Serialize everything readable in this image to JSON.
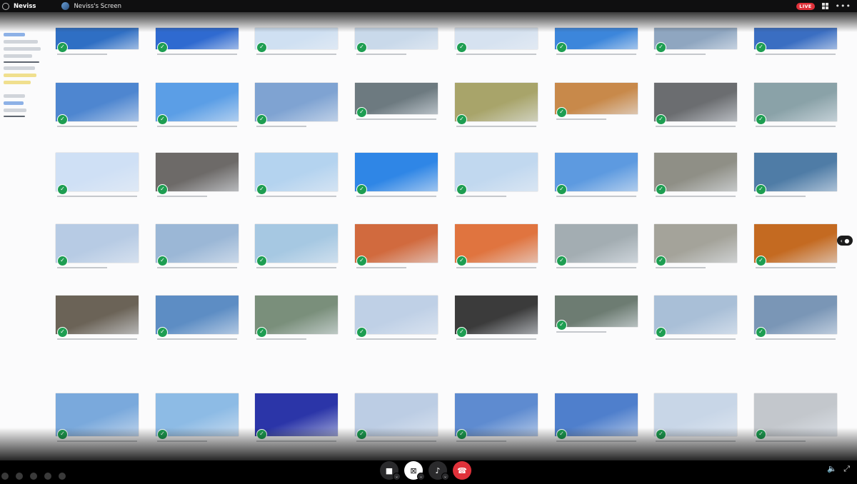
{
  "titlebar": {
    "app_name": "Neviss",
    "screen_title": "Neviss's Screen",
    "live_label": "LIVE",
    "icons": {
      "app": "app-logo-icon",
      "grid": "grid-view-icon",
      "more": "more-options-icon"
    },
    "colors": {
      "live": "#e0313a",
      "bar": "#0f0f10"
    }
  },
  "gallery": {
    "description_note": "grid of sky photo thumbnails with green check badges",
    "check_glyph": "✓",
    "accent_color": "#1e9e52",
    "rows": [
      [
        "#2f6fc4",
        "#2f6ad0",
        "#cfe0f2",
        "#c9d9ea",
        "#d6e2f0",
        "#3c86db",
        "#8fa6c0",
        "#3a6ec2"
      ],
      [
        "#4e86d0",
        "#5b9ee6",
        "#7fa3d2",
        "#6d7a80",
        "#a8a46a",
        "#c8894a",
        "#6b6d70",
        "#8aa2a8"
      ],
      [
        "#cfe0f5",
        "#6d6a68",
        "#b4d3ef",
        "#2f86e6",
        "#c1d8ef",
        "#5d9ae0",
        "#8f8f86",
        "#4f7ca6"
      ],
      [
        "#b7cbe4",
        "#9bb7d6",
        "#a6c8e2",
        "#d16a3e",
        "#e0743f",
        "#a3adb2",
        "#a4a39a",
        "#c46a21"
      ],
      [
        "#6b6357",
        "#5d8dc4",
        "#7a8f7b",
        "#bfd0e6",
        "#3b3b3b",
        "#6d7c72",
        "#a9bfd7",
        "#7a96b6"
      ],
      [
        "#7aa9dc",
        "#8dbbe5",
        "#2b35a8",
        "#bccde4",
        "#5e8bd0",
        "#4f7fcc",
        "#c8d6e7",
        "#c3c7cc"
      ]
    ]
  },
  "controls": {
    "camera": "camera-icon",
    "stop_share": "stop-share-icon",
    "microphone": "microphone-icon",
    "end_call": "end-call-icon",
    "volume": "volume-icon",
    "fullscreen": "fullscreen-icon",
    "end_color": "#e0313a"
  }
}
